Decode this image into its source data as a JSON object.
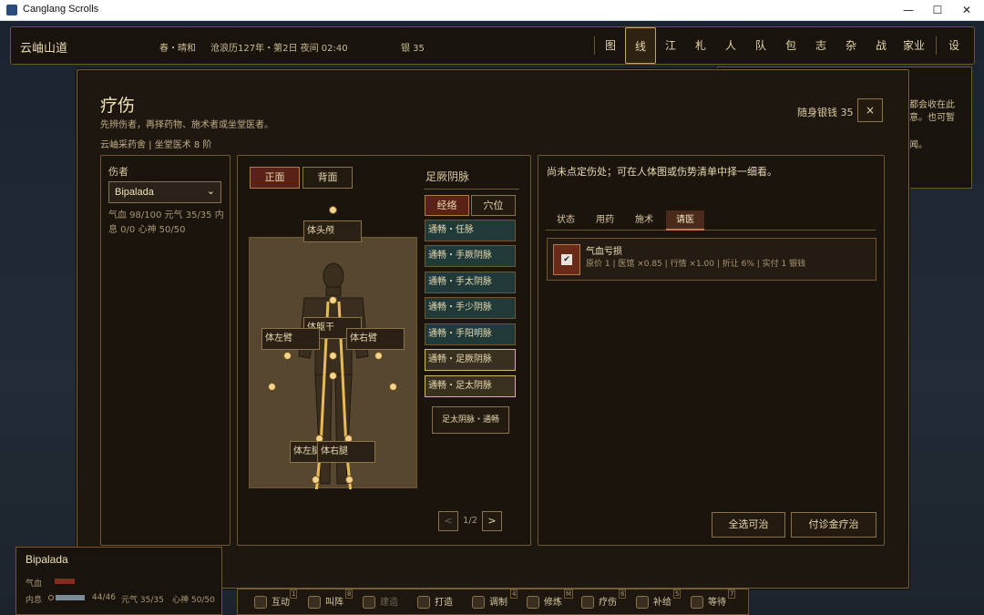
{
  "window": {
    "title": "Canglang Scrolls",
    "minimize": "—",
    "maximize": "☐",
    "close": "✕"
  },
  "top": {
    "location": "云岫山道",
    "season": "春・晴和",
    "date": "沧浪历127年・第2日 夜间 02:40",
    "silver": "银 35",
    "nav": [
      "图",
      "线",
      "江",
      "札",
      "人",
      "队",
      "包",
      "志",
      "杂",
      "战",
      "家业",
      "设"
    ],
    "active_nav": "线"
  },
  "sidecard": {
    "line1": "都会收在此",
    "line2": "意。也可暂",
    "line3": "闻。"
  },
  "modal": {
    "title": "疗伤",
    "subtitle": "先辨伤者，再择药物、施术者或坐堂医者。",
    "clinic": "云岫采药舍 | 坐堂医术 8 阶",
    "money": "随身银钱 35",
    "close": "×"
  },
  "left": {
    "label": "伤者",
    "patient": "Bipalada",
    "stats": "气血 98/100  元气 35/35  内息 0/0  心神 50/50"
  },
  "body": {
    "front": "正面",
    "back": "背面",
    "parts": {
      "head": "体头颅",
      "torso": "体躯干",
      "larm": "体左臂",
      "rarm": "体右臂",
      "lleg": "体左腿",
      "rleg": "体右腿"
    }
  },
  "meridians": {
    "title": "足厥阴脉",
    "tab_jing": "经络",
    "tab_xue": "穴位",
    "items": [
      "通畅・任脉",
      "通畅・手厥阴脉",
      "通畅・手太阴脉",
      "通畅・手少阴脉",
      "通畅・手阳明脉",
      "通畅・足厥阴脉",
      "通畅・足太阴脉"
    ],
    "selected": "足太阴脉・通畅",
    "page": "1/2",
    "prev": "<",
    "next": ">"
  },
  "right": {
    "hint": "尚未点定伤处；可在人体图或伤势清单中择一细看。",
    "tabs": [
      "状态",
      "用药",
      "施术",
      "请医"
    ],
    "active_tab": "请医",
    "item": {
      "name": "气血亏损",
      "detail": "原价 1 | 医馆 ×0.85 | 行情 ×1.00 | 折让 6% | 实付 1 银钱",
      "checked": "✔"
    },
    "select_all": "全选可治",
    "pay": "付诊金疗治"
  },
  "char": {
    "name": "Bipalada",
    "hp_label": "气血",
    "neixi_label": "内息",
    "neixi": "44/46",
    "yuanqi": "元气 35/35",
    "xinshen": "心神 50/50"
  },
  "actions": [
    {
      "label": "互动",
      "key": "1"
    },
    {
      "label": "叫阵",
      "key": "8"
    },
    {
      "label": "建造",
      "key": "",
      "dim": true
    },
    {
      "label": "打造",
      "key": ""
    },
    {
      "label": "调制",
      "key": "4"
    },
    {
      "label": "修炼",
      "key": "M"
    },
    {
      "label": "疗伤",
      "key": "6"
    },
    {
      "label": "补给",
      "key": "5"
    },
    {
      "label": "等待",
      "key": "7"
    }
  ]
}
